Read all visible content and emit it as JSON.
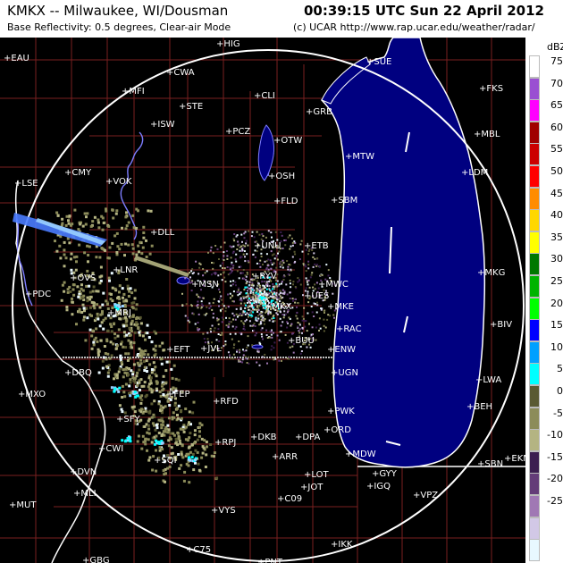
{
  "header": {
    "station": "KMKX -- Milwaukee, WI/Dousman",
    "time": "00:39:15 UTC Sun 22 April 2012",
    "product": "Base Reflectivity: 0.5 degrees, Clear-air Mode",
    "credit": "(c) UCAR  http://www.rap.ucar.edu/weather/radar/"
  },
  "legend": {
    "unit": "dBZ",
    "levels": [
      {
        "label": "75",
        "color": "#ffffff"
      },
      {
        "label": "70",
        "color": "#9a4fd2"
      },
      {
        "label": "65",
        "color": "#ff00ff"
      },
      {
        "label": "60",
        "color": "#a00000"
      },
      {
        "label": "55",
        "color": "#cc0000"
      },
      {
        "label": "50",
        "color": "#ff0000"
      },
      {
        "label": "45",
        "color": "#ff8c00"
      },
      {
        "label": "40",
        "color": "#ffd700"
      },
      {
        "label": "35",
        "color": "#ffff00"
      },
      {
        "label": "30",
        "color": "#007800"
      },
      {
        "label": "25",
        "color": "#00b400"
      },
      {
        "label": "20",
        "color": "#00ff00"
      },
      {
        "label": "15",
        "color": "#0000ff"
      },
      {
        "label": "10",
        "color": "#00a0ff"
      },
      {
        "label": "5",
        "color": "#00ffff"
      },
      {
        "label": "0",
        "color": "#5a5a32"
      },
      {
        "label": "-5",
        "color": "#8c8c5a"
      },
      {
        "label": "-10",
        "color": "#b4b482"
      },
      {
        "label": "-15",
        "color": "#3c1e50"
      },
      {
        "label": "-20",
        "color": "#643c78"
      },
      {
        "label": "-25",
        "color": "#a078b4"
      },
      {
        "label": "",
        "color": "#d2c8e6"
      },
      {
        "label": "",
        "color": "#e8f8ff"
      }
    ]
  },
  "map": {
    "colors": {
      "background": "#000000",
      "lake": "#000080",
      "range_ring": "#ffffff",
      "county": "#7a2020",
      "state": "#ffffff"
    },
    "cities": [
      {
        "id": "EAU",
        "name": "EAU",
        "dim": true
      },
      {
        "id": "HIG",
        "name": "HIG",
        "dim": true
      },
      {
        "id": "CWA",
        "name": "CWA"
      },
      {
        "id": "MFI",
        "name": "MFI"
      },
      {
        "id": "STE",
        "name": "STE"
      },
      {
        "id": "CLI",
        "name": "CLI"
      },
      {
        "id": "GRB",
        "name": "GRB"
      },
      {
        "id": "ISW",
        "name": "ISW"
      },
      {
        "id": "PCZ",
        "name": "PCZ"
      },
      {
        "id": "OTW",
        "name": "OTW"
      },
      {
        "id": "MTW",
        "name": "MTW"
      },
      {
        "id": "OSH",
        "name": "OSH"
      },
      {
        "id": "CMY",
        "name": "CMY"
      },
      {
        "id": "VOK",
        "name": "VOK"
      },
      {
        "id": "LSE",
        "name": "LSE"
      },
      {
        "id": "FLD",
        "name": "FLD"
      },
      {
        "id": "SBM",
        "name": "SBM"
      },
      {
        "id": "DLL",
        "name": "DLL"
      },
      {
        "id": "UNU",
        "name": "UNU"
      },
      {
        "id": "ETB",
        "name": "ETB"
      },
      {
        "id": "LNR",
        "name": "LNR"
      },
      {
        "id": "OVS",
        "name": "OVS"
      },
      {
        "id": "RYV",
        "name": "RYV"
      },
      {
        "id": "PDC",
        "name": "PDC"
      },
      {
        "id": "MSN",
        "name": "MSN"
      },
      {
        "id": "MWC",
        "name": "MWC"
      },
      {
        "id": "UES",
        "name": "UES"
      },
      {
        "id": "MKX",
        "name": "MKX"
      },
      {
        "id": "MKE",
        "name": "MKE"
      },
      {
        "id": "MRJ",
        "name": "MRJ"
      },
      {
        "id": "RAC",
        "name": "RAC"
      },
      {
        "id": "EFT",
        "name": "EFT"
      },
      {
        "id": "JVL",
        "name": "JVL"
      },
      {
        "id": "BUU",
        "name": "BUU"
      },
      {
        "id": "ENW",
        "name": "ENW"
      },
      {
        "id": "DBQ",
        "name": "DBQ"
      },
      {
        "id": "UGN",
        "name": "UGN"
      },
      {
        "id": "MXO",
        "name": "MXO"
      },
      {
        "id": "FEP",
        "name": "FEP"
      },
      {
        "id": "RFD",
        "name": "RFD"
      },
      {
        "id": "PWK",
        "name": "PWK"
      },
      {
        "id": "SFY",
        "name": "SFY"
      },
      {
        "id": "ORD",
        "name": "ORD"
      },
      {
        "id": "RPJ",
        "name": "RPJ"
      },
      {
        "id": "DKB",
        "name": "DKB"
      },
      {
        "id": "DPA",
        "name": "DPA"
      },
      {
        "id": "CWI",
        "name": "CWI"
      },
      {
        "id": "MDW",
        "name": "MDW"
      },
      {
        "id": "ARR",
        "name": "ARR"
      },
      {
        "id": "SQI",
        "name": "SQI"
      },
      {
        "id": "LOT",
        "name": "LOT"
      },
      {
        "id": "GYY",
        "name": "GYY"
      },
      {
        "id": "DVN",
        "name": "DVN"
      },
      {
        "id": "IGQ",
        "name": "IGQ"
      },
      {
        "id": "JOT",
        "name": "JOT"
      },
      {
        "id": "MLI",
        "name": "MLI"
      },
      {
        "id": "VPZ",
        "name": "VPZ"
      },
      {
        "id": "C09",
        "name": "C09"
      },
      {
        "id": "MUT",
        "name": "MUT",
        "dim": true
      },
      {
        "id": "VYS",
        "name": "VYS"
      },
      {
        "id": "C75",
        "name": "C75"
      },
      {
        "id": "IKK",
        "name": "IKK"
      },
      {
        "id": "GBG",
        "name": "GBG",
        "dim": true
      },
      {
        "id": "PNT",
        "name": "PNT"
      },
      {
        "id": "FKS",
        "name": "FKS",
        "dim": true
      },
      {
        "id": "MBL",
        "name": "MBL",
        "dim": true
      },
      {
        "id": "LDM",
        "name": "LDM"
      },
      {
        "id": "MKG",
        "name": "MKG"
      },
      {
        "id": "BIV",
        "name": "BIV"
      },
      {
        "id": "LWA",
        "name": "LWA"
      },
      {
        "id": "BEH",
        "name": "BEH"
      },
      {
        "id": "SBN",
        "name": "SBN",
        "dim": true
      },
      {
        "id": "EKM",
        "name": "EKM"
      },
      {
        "id": "SUE",
        "name": "SUE",
        "dim": true
      }
    ]
  }
}
